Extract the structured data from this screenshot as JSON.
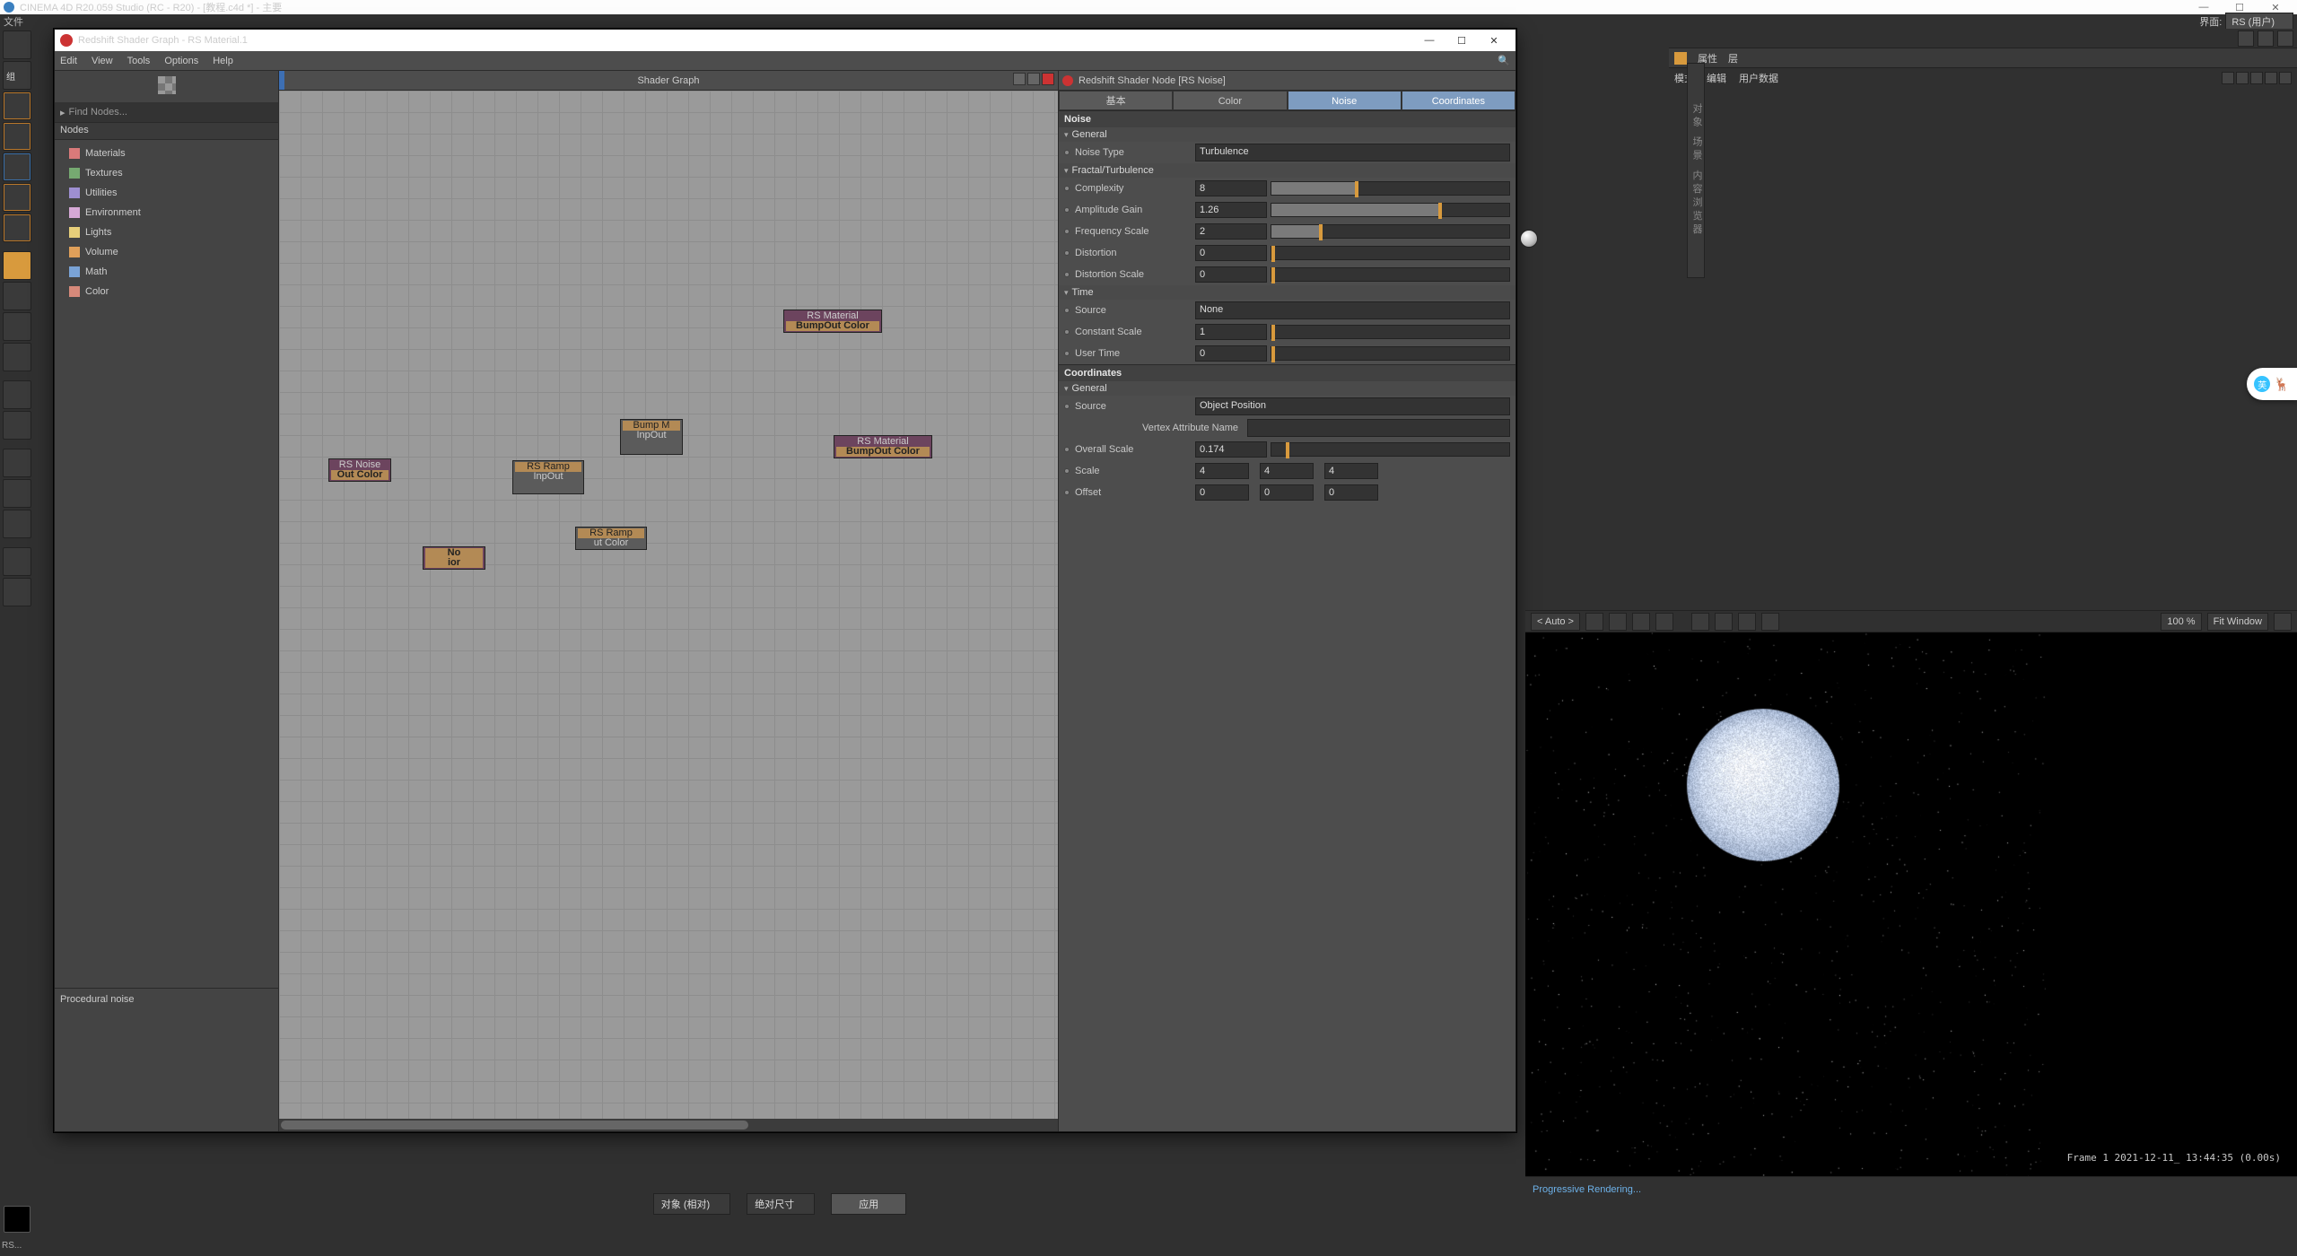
{
  "os_title": "CINEMA 4D R20.059 Studio (RC - R20) - [教程.c4d *] - 主要",
  "c4d_menu": {
    "file": "文件",
    "layout_lbl": "界面:",
    "layout_val": "RS (用户)"
  },
  "shader_window": {
    "title": "Redshift Shader Graph - RS Material.1",
    "menu": {
      "edit": "Edit",
      "view": "View",
      "tools": "Tools",
      "options": "Options",
      "help": "Help"
    },
    "find_placeholder": "Find Nodes...",
    "nodes_header": "Nodes",
    "tree": [
      {
        "label": "Materials",
        "color": "#d97a7a"
      },
      {
        "label": "Textures",
        "color": "#76a971"
      },
      {
        "label": "Utilities",
        "color": "#9e8fd1"
      },
      {
        "label": "Environment",
        "color": "#d6a9d6"
      },
      {
        "label": "Lights",
        "color": "#e7cf7a"
      },
      {
        "label": "Volume",
        "color": "#e0a05a"
      },
      {
        "label": "Math",
        "color": "#7aa3d6"
      },
      {
        "label": "Color",
        "color": "#d6897a"
      }
    ],
    "desc": "Procedural noise",
    "canvas_title": "Shader Graph",
    "nodes": {
      "noise": {
        "t1": "RS Noise",
        "t2": "Out Color"
      },
      "ramp1": {
        "t1": "RS Ramp",
        "t2": "InpOut"
      },
      "ramp2": {
        "t1": "RS Ramp",
        "t2": "ut Color"
      },
      "noise2": {
        "t1": "No",
        "t2": "ior"
      },
      "bump": {
        "t1": "Bump M",
        "t2": "InpOut"
      },
      "mat1": {
        "t1": "RS Material",
        "t2": "BumpOut Color"
      },
      "mat2": {
        "t1": "RS Material",
        "t2": "BumpOut Color"
      }
    }
  },
  "attr": {
    "header": "Redshift Shader Node [RS Noise]",
    "tabs": {
      "basic": "基本",
      "color": "Color",
      "noise": "Noise",
      "coords": "Coordinates"
    },
    "noise_section": "Noise",
    "general": "General",
    "noise_type_lbl": "Noise Type",
    "noise_type_val": "Turbulence",
    "fractal": "Fractal/Turbulence",
    "complexity_lbl": "Complexity",
    "complexity_val": "8",
    "ampgain_lbl": "Amplitude Gain",
    "ampgain_val": "1.26",
    "freqscale_lbl": "Frequency Scale",
    "freqscale_val": "2",
    "distortion_lbl": "Distortion",
    "distortion_val": "0",
    "distscale_lbl": "Distortion Scale",
    "distscale_val": "0",
    "time": "Time",
    "source_lbl": "Source",
    "source_val": "None",
    "constscale_lbl": "Constant Scale",
    "constscale_val": "1",
    "usertime_lbl": "User Time",
    "usertime_val": "0",
    "coords_section": "Coordinates",
    "coords_general": "General",
    "csource_lbl": "Source",
    "csource_val": "Object Position",
    "vattr_lbl": "Vertex Attribute Name",
    "vattr_val": "",
    "oscale_lbl": "Overall Scale",
    "oscale_val": "0.174",
    "scale_lbl": "Scale",
    "scale_x": "4",
    "scale_y": "4",
    "scale_z": "4",
    "offset_lbl": "Offset",
    "offset_x": "0",
    "offset_y": "0",
    "offset_z": "0"
  },
  "app_right": {
    "attr_tab": "属性",
    "layer_tab": "层",
    "mode": "模式",
    "edit": "编辑",
    "userdata": "用户数据"
  },
  "cjk_side": "对象 场景 内容浏览器",
  "render": {
    "auto": "< Auto >",
    "pct": "100 %",
    "fit": "Fit Window",
    "stamp": "Frame  1   2021-12-11_ 13:44:35  (0.00s)",
    "status": "Progressive Rendering..."
  },
  "bottom": {
    "obj": "对象 (相对)",
    "size": "绝对尺寸",
    "apply": "应用"
  },
  "obj_label": "组"
}
